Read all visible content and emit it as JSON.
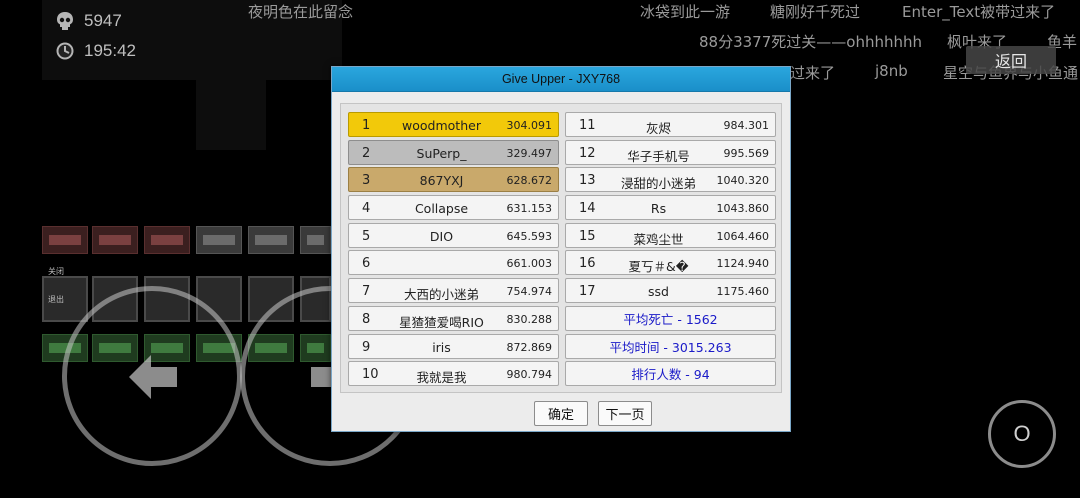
{
  "hud": {
    "deaths": "5947",
    "time": "195:42",
    "deaths_icon": "skull-icon",
    "time_icon": "clock-icon"
  },
  "danmaku": [
    "夜明色在此留念",
    "冰袋到此一游",
    "糖刚好千死过",
    "Enter_Text被带过来了",
    "88分3377死过关——ohhhhhhh",
    "枫叶来了",
    "鱼羊",
    "过来了",
    "j8nb",
    "星空与鱼界与小鱼通"
  ],
  "back_button": "返回",
  "dialog": {
    "title": "Give Upper - JXY768",
    "ranks_left": [
      {
        "rank": "1",
        "name": "woodmother",
        "time": "304.091",
        "medal": "gold"
      },
      {
        "rank": "2",
        "name": "SuPerp_",
        "time": "329.497",
        "medal": "silver"
      },
      {
        "rank": "3",
        "name": "867YXJ",
        "time": "628.672",
        "medal": "bronze"
      },
      {
        "rank": "4",
        "name": "Collapse",
        "time": "631.153",
        "medal": ""
      },
      {
        "rank": "5",
        "name": "DIO",
        "time": "645.593",
        "medal": ""
      },
      {
        "rank": "6",
        "name": "",
        "time": "661.003",
        "medal": ""
      },
      {
        "rank": "7",
        "name": "大西的小迷弟",
        "time": "754.974",
        "medal": ""
      },
      {
        "rank": "8",
        "name": "星猹猹爱喝RIO",
        "time": "830.288",
        "medal": ""
      },
      {
        "rank": "9",
        "name": "iris",
        "time": "872.869",
        "medal": ""
      },
      {
        "rank": "10",
        "name": "我就是我",
        "time": "980.794",
        "medal": ""
      }
    ],
    "ranks_right": [
      {
        "rank": "11",
        "name": "灰烬",
        "time": "984.301"
      },
      {
        "rank": "12",
        "name": "华子手机号",
        "time": "995.569"
      },
      {
        "rank": "13",
        "name": "浸甜的小迷弟",
        "time": "1040.320"
      },
      {
        "rank": "14",
        "name": "Rs",
        "time": "1043.860"
      },
      {
        "rank": "15",
        "name": "菜鸡尘世",
        "time": "1064.460"
      },
      {
        "rank": "16",
        "name": "夏丂＃&�",
        "time": "1124.940"
      },
      {
        "rank": "17",
        "name": "ssd",
        "time": "1175.460"
      }
    ],
    "stats": {
      "avg_deaths": "平均死亡 - 1562",
      "avg_time": "平均时间 - 3015.263",
      "player_count": "排行人数 - 94"
    },
    "confirm_button": "确定",
    "next_page_button": "下一页"
  },
  "controls": {
    "jump_label": "O",
    "left_icon": "arrow-left-icon",
    "right_icon": "arrow-right-icon"
  },
  "scene_labels": {
    "left_a": "关闭",
    "left_b": "退出"
  },
  "colors": {
    "title_bar": "#1f9ad3",
    "gold": "#f2c90a",
    "silver": "#bcbcbc",
    "bronze": "#c9a96b",
    "stat_text": "#1a1ac8"
  }
}
